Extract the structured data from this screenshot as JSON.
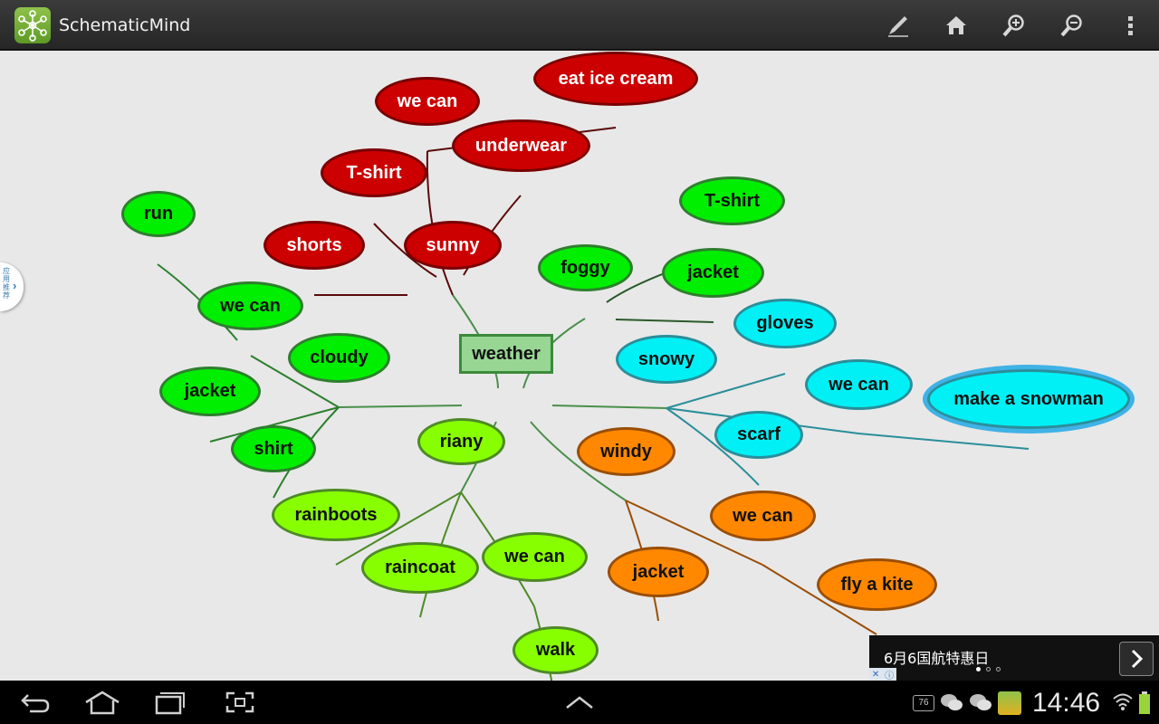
{
  "app": {
    "title": "SchematicMind"
  },
  "side_tab": {
    "label": "应用推荐"
  },
  "mindmap": {
    "root": "weather",
    "nodes": [
      {
        "id": "n1",
        "label": "we can",
        "color": "red"
      },
      {
        "id": "n2",
        "label": "eat ice cream",
        "color": "red"
      },
      {
        "id": "n3",
        "label": "underwear",
        "color": "red"
      },
      {
        "id": "n4",
        "label": "T-shirt",
        "color": "red"
      },
      {
        "id": "n5",
        "label": "shorts",
        "color": "red"
      },
      {
        "id": "n6",
        "label": "sunny",
        "color": "red"
      },
      {
        "id": "n7",
        "label": "T-shirt",
        "color": "green"
      },
      {
        "id": "n8",
        "label": "foggy",
        "color": "green"
      },
      {
        "id": "n9",
        "label": "jacket",
        "color": "green"
      },
      {
        "id": "n10",
        "label": "run",
        "color": "green"
      },
      {
        "id": "n11",
        "label": "we can",
        "color": "green"
      },
      {
        "id": "n12",
        "label": "cloudy",
        "color": "green"
      },
      {
        "id": "n13",
        "label": "jacket",
        "color": "green"
      },
      {
        "id": "n14",
        "label": "shirt",
        "color": "green"
      },
      {
        "id": "n15",
        "label": "weather",
        "color": "root"
      },
      {
        "id": "n16",
        "label": "gloves",
        "color": "cyan"
      },
      {
        "id": "n17",
        "label": "snowy",
        "color": "cyan"
      },
      {
        "id": "n18",
        "label": "we can",
        "color": "cyan"
      },
      {
        "id": "n19",
        "label": "make a snowman",
        "color": "cyan"
      },
      {
        "id": "n20",
        "label": "scarf",
        "color": "cyan"
      },
      {
        "id": "n21",
        "label": "riany",
        "color": "lime"
      },
      {
        "id": "n22",
        "label": "rainboots",
        "color": "lime"
      },
      {
        "id": "n23",
        "label": "raincoat",
        "color": "lime"
      },
      {
        "id": "n24",
        "label": "we can",
        "color": "lime"
      },
      {
        "id": "n25",
        "label": "walk",
        "color": "lime"
      },
      {
        "id": "n26",
        "label": "windy",
        "color": "orange"
      },
      {
        "id": "n27",
        "label": "we can",
        "color": "orange"
      },
      {
        "id": "n28",
        "label": "jacket",
        "color": "orange"
      },
      {
        "id": "n29",
        "label": "fly a kite",
        "color": "orange"
      }
    ],
    "selected": "make a snowman"
  },
  "colors": {
    "red": "#cc0000",
    "green": "#00ee00",
    "lime": "#88ff00",
    "cyan": "#00f0f5",
    "orange": "#ff8800",
    "root": "#98d694",
    "selection": "#3fb2e6",
    "canvas": "#e8e8e8"
  },
  "ad": {
    "text": "6月6国航特惠日",
    "page": 1,
    "pages": 3
  },
  "status": {
    "time": "14:46",
    "badge": "76"
  },
  "icons": [
    "app-logo-icon",
    "pencil-icon",
    "home-icon",
    "zoom-in-icon",
    "zoom-out-icon",
    "overflow-menu-icon",
    "back-icon",
    "home-nav-icon",
    "recent-apps-icon",
    "screenshot-icon",
    "up-arrow-icon",
    "wechat-icon",
    "wifi-icon",
    "battery-icon"
  ]
}
